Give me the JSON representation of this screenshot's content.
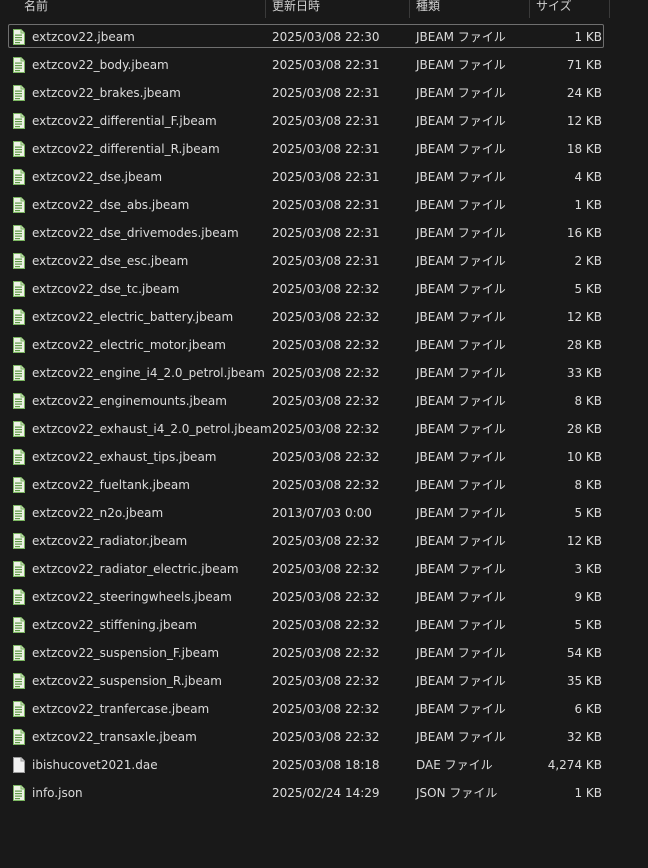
{
  "header": {
    "name": "名前",
    "date": "更新日時",
    "type": "種類",
    "size": "サイズ"
  },
  "files": [
    {
      "name": "extzcov22.jbeam",
      "date": "2025/03/08 22:30",
      "type": "JBEAM ファイル",
      "size": "1 KB",
      "icon": "jbeam-file-icon"
    },
    {
      "name": "extzcov22_body.jbeam",
      "date": "2025/03/08 22:31",
      "type": "JBEAM ファイル",
      "size": "71 KB",
      "icon": "jbeam-file-icon"
    },
    {
      "name": "extzcov22_brakes.jbeam",
      "date": "2025/03/08 22:31",
      "type": "JBEAM ファイル",
      "size": "24 KB",
      "icon": "jbeam-file-icon"
    },
    {
      "name": "extzcov22_differential_F.jbeam",
      "date": "2025/03/08 22:31",
      "type": "JBEAM ファイル",
      "size": "12 KB",
      "icon": "jbeam-file-icon"
    },
    {
      "name": "extzcov22_differential_R.jbeam",
      "date": "2025/03/08 22:31",
      "type": "JBEAM ファイル",
      "size": "18 KB",
      "icon": "jbeam-file-icon"
    },
    {
      "name": "extzcov22_dse.jbeam",
      "date": "2025/03/08 22:31",
      "type": "JBEAM ファイル",
      "size": "4 KB",
      "icon": "jbeam-file-icon"
    },
    {
      "name": "extzcov22_dse_abs.jbeam",
      "date": "2025/03/08 22:31",
      "type": "JBEAM ファイル",
      "size": "1 KB",
      "icon": "jbeam-file-icon"
    },
    {
      "name": "extzcov22_dse_drivemodes.jbeam",
      "date": "2025/03/08 22:31",
      "type": "JBEAM ファイル",
      "size": "16 KB",
      "icon": "jbeam-file-icon"
    },
    {
      "name": "extzcov22_dse_esc.jbeam",
      "date": "2025/03/08 22:31",
      "type": "JBEAM ファイル",
      "size": "2 KB",
      "icon": "jbeam-file-icon"
    },
    {
      "name": "extzcov22_dse_tc.jbeam",
      "date": "2025/03/08 22:32",
      "type": "JBEAM ファイル",
      "size": "5 KB",
      "icon": "jbeam-file-icon"
    },
    {
      "name": "extzcov22_electric_battery.jbeam",
      "date": "2025/03/08 22:32",
      "type": "JBEAM ファイル",
      "size": "12 KB",
      "icon": "jbeam-file-icon"
    },
    {
      "name": "extzcov22_electric_motor.jbeam",
      "date": "2025/03/08 22:32",
      "type": "JBEAM ファイル",
      "size": "28 KB",
      "icon": "jbeam-file-icon"
    },
    {
      "name": "extzcov22_engine_i4_2.0_petrol.jbeam",
      "date": "2025/03/08 22:32",
      "type": "JBEAM ファイル",
      "size": "33 KB",
      "icon": "jbeam-file-icon"
    },
    {
      "name": "extzcov22_enginemounts.jbeam",
      "date": "2025/03/08 22:32",
      "type": "JBEAM ファイル",
      "size": "8 KB",
      "icon": "jbeam-file-icon"
    },
    {
      "name": "extzcov22_exhaust_i4_2.0_petrol.jbeam",
      "date": "2025/03/08 22:32",
      "type": "JBEAM ファイル",
      "size": "28 KB",
      "icon": "jbeam-file-icon"
    },
    {
      "name": "extzcov22_exhaust_tips.jbeam",
      "date": "2025/03/08 22:32",
      "type": "JBEAM ファイル",
      "size": "10 KB",
      "icon": "jbeam-file-icon"
    },
    {
      "name": "extzcov22_fueltank.jbeam",
      "date": "2025/03/08 22:32",
      "type": "JBEAM ファイル",
      "size": "8 KB",
      "icon": "jbeam-file-icon"
    },
    {
      "name": "extzcov22_n2o.jbeam",
      "date": "2013/07/03 0:00",
      "type": "JBEAM ファイル",
      "size": "5 KB",
      "icon": "jbeam-file-icon"
    },
    {
      "name": "extzcov22_radiator.jbeam",
      "date": "2025/03/08 22:32",
      "type": "JBEAM ファイル",
      "size": "12 KB",
      "icon": "jbeam-file-icon"
    },
    {
      "name": "extzcov22_radiator_electric.jbeam",
      "date": "2025/03/08 22:32",
      "type": "JBEAM ファイル",
      "size": "3 KB",
      "icon": "jbeam-file-icon"
    },
    {
      "name": "extzcov22_steeringwheels.jbeam",
      "date": "2025/03/08 22:32",
      "type": "JBEAM ファイル",
      "size": "9 KB",
      "icon": "jbeam-file-icon"
    },
    {
      "name": "extzcov22_stiffening.jbeam",
      "date": "2025/03/08 22:32",
      "type": "JBEAM ファイル",
      "size": "5 KB",
      "icon": "jbeam-file-icon"
    },
    {
      "name": "extzcov22_suspension_F.jbeam",
      "date": "2025/03/08 22:32",
      "type": "JBEAM ファイル",
      "size": "54 KB",
      "icon": "jbeam-file-icon"
    },
    {
      "name": "extzcov22_suspension_R.jbeam",
      "date": "2025/03/08 22:32",
      "type": "JBEAM ファイル",
      "size": "35 KB",
      "icon": "jbeam-file-icon"
    },
    {
      "name": "extzcov22_tranfercase.jbeam",
      "date": "2025/03/08 22:32",
      "type": "JBEAM ファイル",
      "size": "6 KB",
      "icon": "jbeam-file-icon"
    },
    {
      "name": "extzcov22_transaxle.jbeam",
      "date": "2025/03/08 22:32",
      "type": "JBEAM ファイル",
      "size": "32 KB",
      "icon": "jbeam-file-icon"
    },
    {
      "name": "ibishucovet2021.dae",
      "date": "2025/03/08 18:18",
      "type": "DAE ファイル",
      "size": "4,274 KB",
      "icon": "blank-file-icon"
    },
    {
      "name": "info.json",
      "date": "2025/02/24 14:29",
      "type": "JSON ファイル",
      "size": "1 KB",
      "icon": "jbeam-file-icon"
    }
  ],
  "selected_index": 0,
  "colors": {
    "background": "#191919",
    "text": "#dcdcdc",
    "selection_border": "#6f6f6f",
    "file_icon_green": "#7bb661",
    "blank_icon": "#e8e8e8"
  }
}
